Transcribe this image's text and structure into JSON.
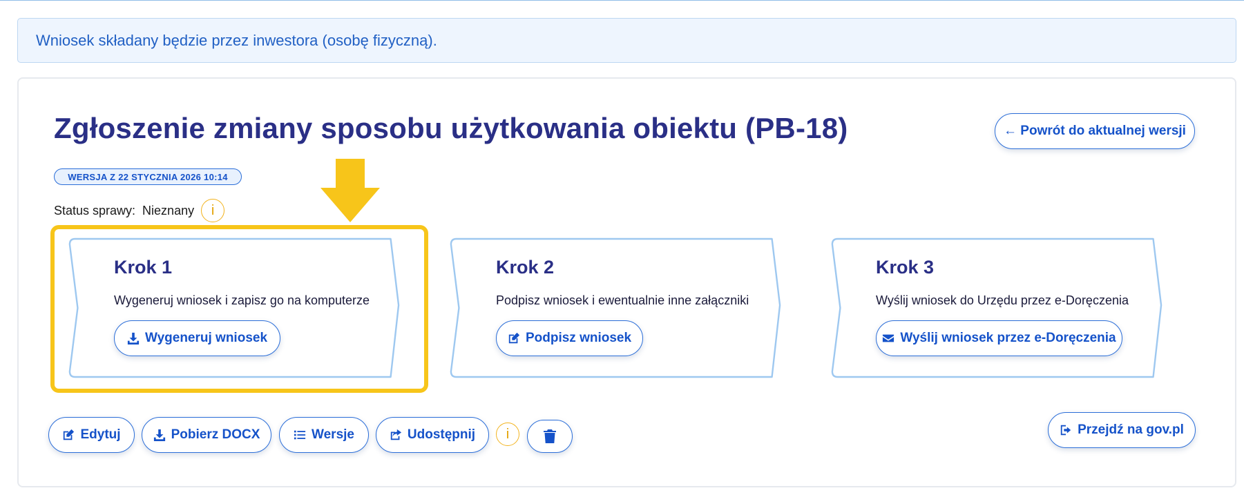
{
  "banner": {
    "text": "Wniosek składany będzie przez inwestora (osobę fizyczną)."
  },
  "page": {
    "title": "Zgłoszenie zmiany sposobu użytkowania obiektu (PB-18)",
    "version_badge": "WERSJA Z 22 STYCZNIA 2026 10:14",
    "status_label": "Status sprawy:",
    "status_value": "Nieznany",
    "info_glyph": "i"
  },
  "header_actions": {
    "back_label": "← Powrót do aktualnej wersji"
  },
  "steps": [
    {
      "title": "Krok 1",
      "description": "Wygeneruj wniosek i zapisz go na komputerze",
      "button_label": "Wygeneruj wniosek",
      "button_icon": "download-icon",
      "highlighted": true
    },
    {
      "title": "Krok 2",
      "description": "Podpisz wniosek i ewentualnie inne załączniki",
      "button_label": "Podpisz wniosek",
      "button_icon": "edit-icon",
      "highlighted": false
    },
    {
      "title": "Krok 3",
      "description": "Wyślij wniosek do Urzędu przez e-Doręczenia",
      "button_label": "Wyślij wniosek przez e-Doręczenia",
      "button_icon": "envelope-icon",
      "highlighted": false
    }
  ],
  "toolbar": {
    "edit_label": "Edytuj",
    "download_docx_label": "Pobierz DOCX",
    "versions_label": "Wersje",
    "share_label": "Udostępnij",
    "delete_icon": "trash-icon",
    "gov_label": "Przejdź na gov.pl"
  },
  "colors": {
    "brand_title": "#2a2f86",
    "accent_blue": "#1552c9",
    "highlight_yellow": "#f7c51a",
    "banner_bg": "#eef5fe",
    "step_border": "#9ec8f0"
  }
}
